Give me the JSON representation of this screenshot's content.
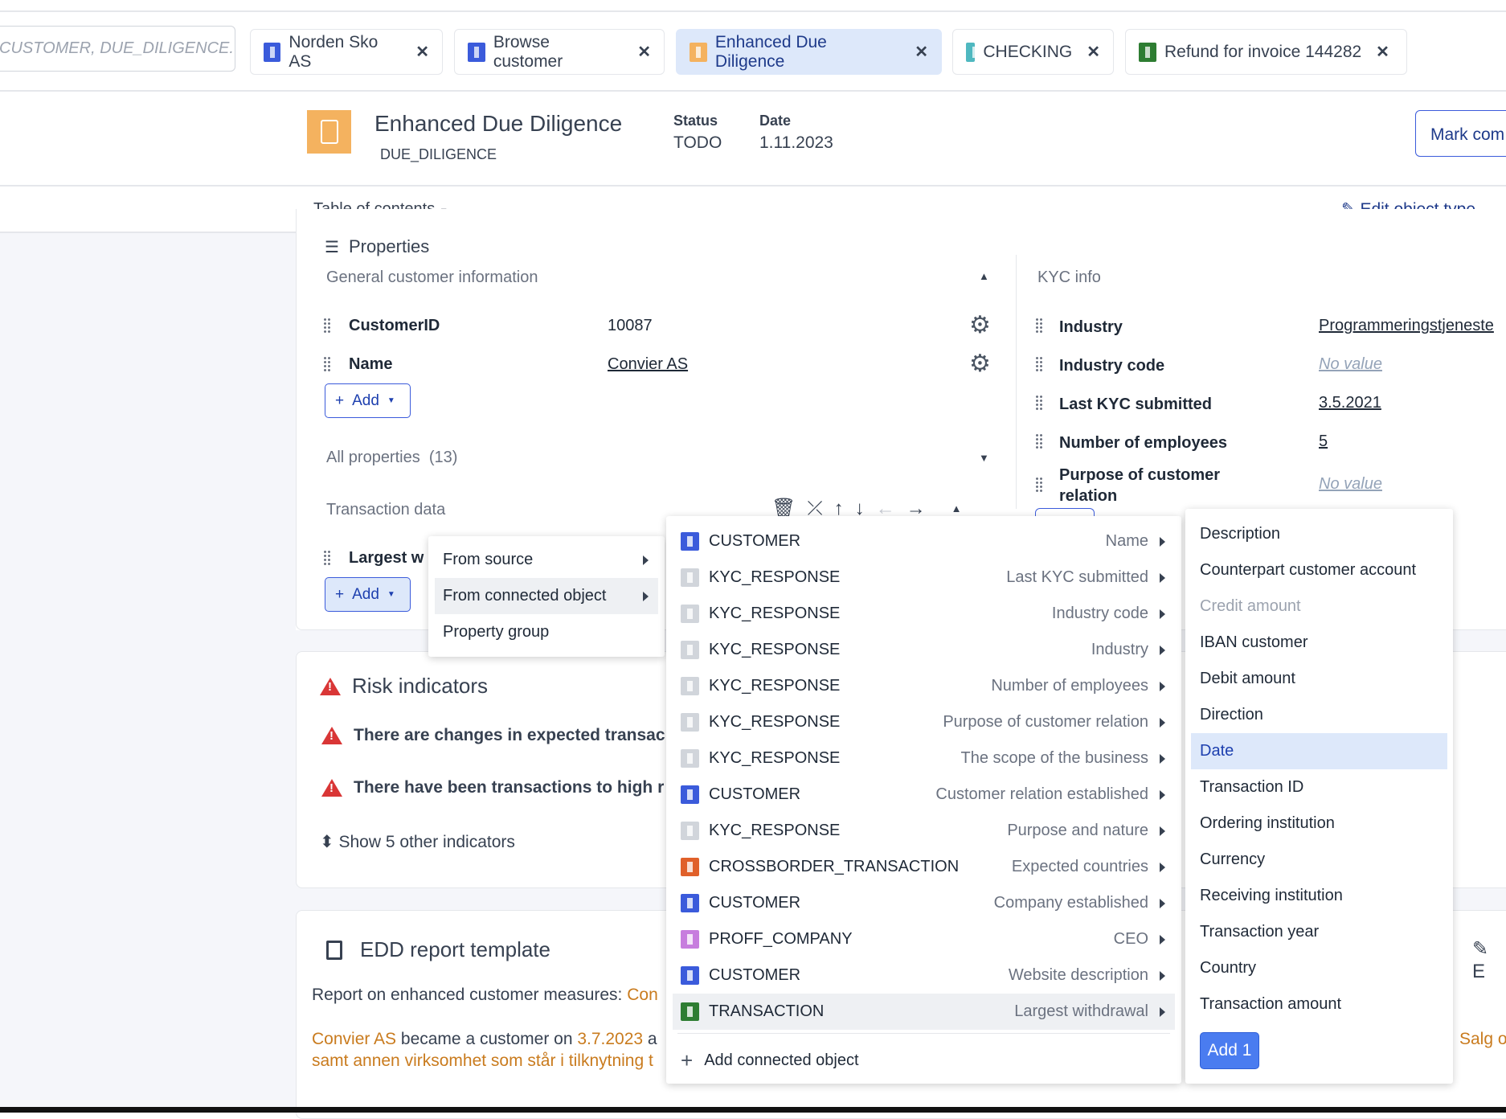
{
  "search": {
    "value": "CUSTOMER, DUE_DILIGENCE."
  },
  "tabs": [
    {
      "label": "Norden Sko AS",
      "color": "#3b5bdb",
      "active": false
    },
    {
      "label": "Browse customer",
      "color": "#3b5bdb",
      "active": false
    },
    {
      "label": "Enhanced Due Diligence",
      "color": "#f4b25f",
      "active": true
    },
    {
      "label": "CHECKING",
      "color": "#4fb8c0",
      "active": false
    },
    {
      "label": "Refund for invoice 144282",
      "color": "#2e7d32",
      "active": false
    }
  ],
  "header": {
    "title": "Enhanced Due Diligence",
    "type": "DUE_DILIGENCE",
    "status_label": "Status",
    "status": "TODO",
    "date_label": "Date",
    "date": "1.11.2023",
    "mark_button": "Mark com",
    "icon_color": "#f4b25f"
  },
  "toolbar": {
    "toc": "Table of contents",
    "edit": "Edit object type"
  },
  "properties": {
    "partial_title": "Properties",
    "general": {
      "title": "General customer information",
      "rows": [
        {
          "label": "CustomerID",
          "value": "10087"
        },
        {
          "label": "Name",
          "value": "Convier AS"
        }
      ],
      "add": "Add"
    },
    "all": {
      "label": "All properties",
      "count": "(13)"
    },
    "transaction": {
      "title": "Transaction data",
      "row_label": "Largest w",
      "add": "Add"
    },
    "kyc": {
      "title": "KYC info",
      "rows": [
        {
          "label": "Industry",
          "value": "Programmeringstjeneste"
        },
        {
          "label": "Industry code",
          "value": "No value"
        },
        {
          "label": "Last KYC submitted",
          "value": "3.5.2021"
        },
        {
          "label": "Number of employees",
          "value": "5"
        },
        {
          "label": "Purpose of customer relation",
          "value": "No value"
        }
      ]
    }
  },
  "add_menu": {
    "items": [
      "From source",
      "From connected object",
      "Property group"
    ]
  },
  "connected_menu": {
    "items": [
      {
        "object": "CUSTOMER",
        "property": "Name",
        "color": "#3b5bdb"
      },
      {
        "object": "KYC_RESPONSE",
        "property": "Last KYC submitted",
        "color": "#d1d5db"
      },
      {
        "object": "KYC_RESPONSE",
        "property": "Industry code",
        "color": "#d1d5db"
      },
      {
        "object": "KYC_RESPONSE",
        "property": "Industry",
        "color": "#d1d5db"
      },
      {
        "object": "KYC_RESPONSE",
        "property": "Number of employees",
        "color": "#d1d5db"
      },
      {
        "object": "KYC_RESPONSE",
        "property": "Purpose of customer relation",
        "color": "#d1d5db"
      },
      {
        "object": "KYC_RESPONSE",
        "property": "The scope of the business",
        "color": "#d1d5db"
      },
      {
        "object": "CUSTOMER",
        "property": "Customer relation established",
        "color": "#3b5bdb"
      },
      {
        "object": "KYC_RESPONSE",
        "property": "Purpose and nature",
        "color": "#d1d5db"
      },
      {
        "object": "CROSSBORDER_TRANSACTION",
        "property": "Expected countries",
        "color": "#e0602a"
      },
      {
        "object": "CUSTOMER",
        "property": "Company established",
        "color": "#3b5bdb"
      },
      {
        "object": "PROFF_COMPANY",
        "property": "CEO",
        "color": "#c77dde"
      },
      {
        "object": "CUSTOMER",
        "property": "Website description",
        "color": "#3b5bdb"
      },
      {
        "object": "TRANSACTION",
        "property": "Largest withdrawal",
        "color": "#2e7d32"
      }
    ],
    "add_connected": "Add connected object"
  },
  "field_menu": {
    "items": [
      "Description",
      "Counterpart customer account",
      "Credit amount",
      "IBAN customer",
      "Debit amount",
      "Direction",
      "Date",
      "Transaction ID",
      "Ordering institution",
      "Currency",
      "Receiving institution",
      "Transaction year",
      "Country",
      "Transaction amount"
    ],
    "disabled": "Credit amount",
    "selected": "Date",
    "add_button": "Add 1"
  },
  "risk": {
    "title": "Risk indicators",
    "items": [
      "There are changes in expected transac",
      "There have been transactions to high r"
    ],
    "show_more": "Show 5 other indicators"
  },
  "report": {
    "title": "EDD report template",
    "line1_prefix": "Report on enhanced customer measures: ",
    "line1_link": "Con",
    "line2_link": "Convier AS",
    "line2_mid": " became a customer on ",
    "line2_date": "3.7.2023",
    "line2_end": " a",
    "line3": "samt annen virksomhet som står i tilknytning t",
    "right_edit": "E",
    "right_link": "Salg o"
  }
}
